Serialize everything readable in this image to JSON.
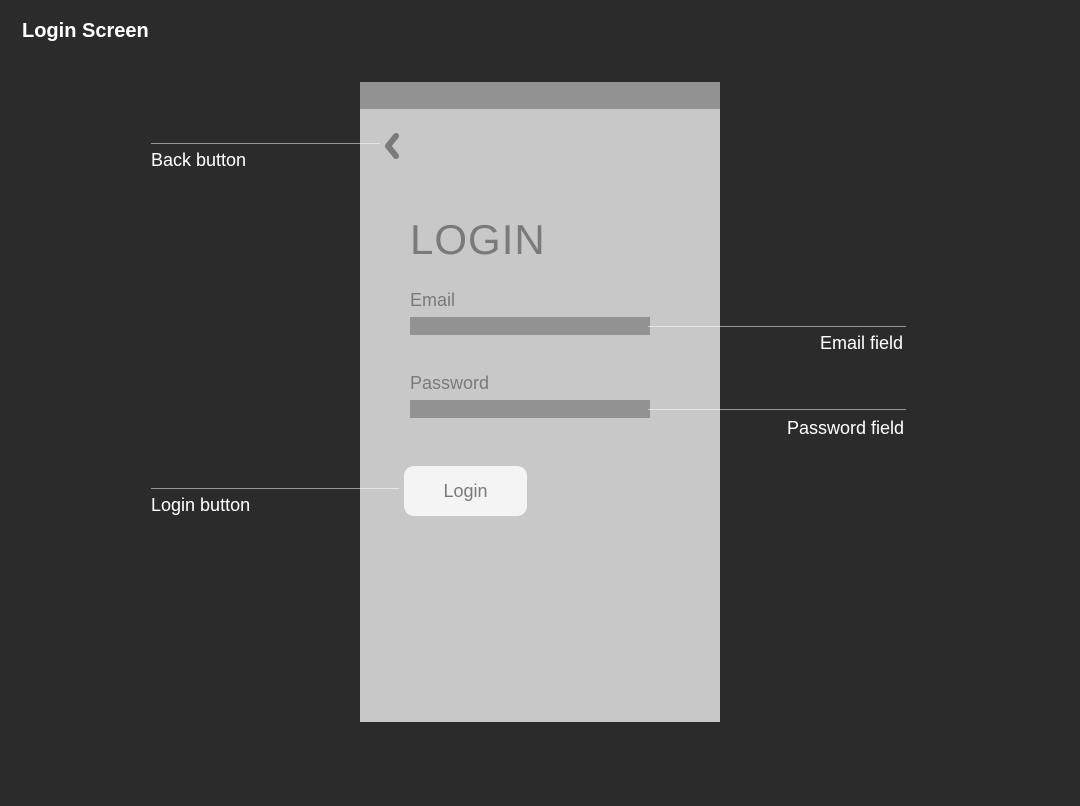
{
  "page": {
    "title": "Login Screen"
  },
  "phone": {
    "heading": "LOGIN",
    "email_label": "Email",
    "email_value": "",
    "password_label": "Password",
    "password_value": "",
    "login_button_label": "Login"
  },
  "annotations": {
    "back_button": "Back button",
    "login_button": "Login button",
    "email_field": "Email field",
    "password_field": "Password field"
  }
}
